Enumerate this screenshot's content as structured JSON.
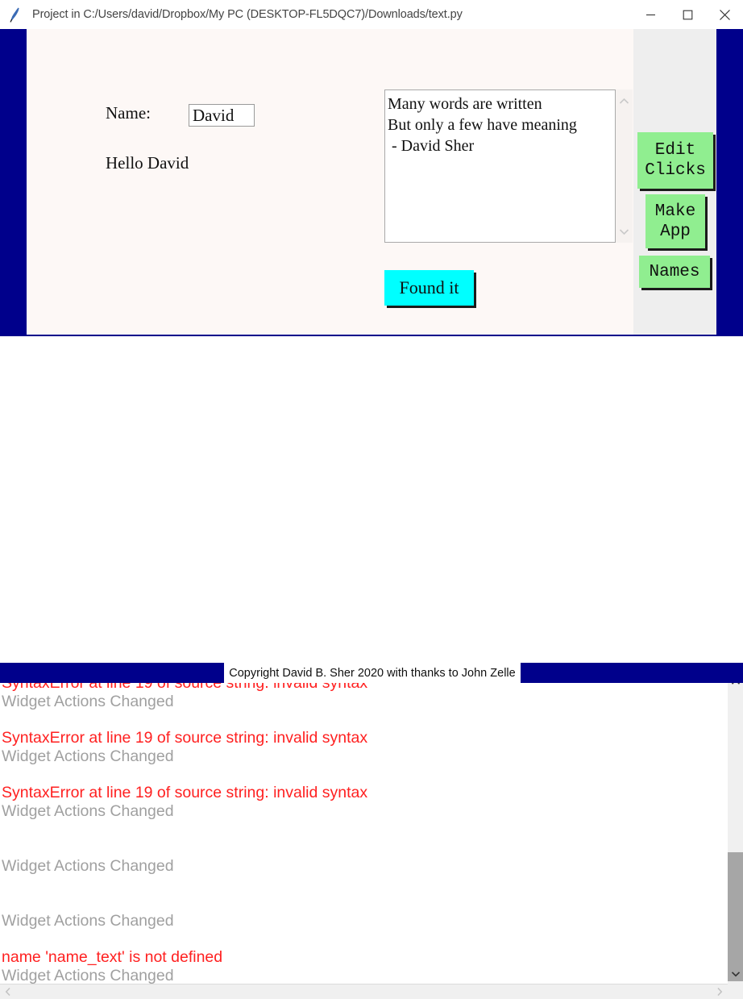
{
  "window": {
    "title": "Project in C:/Users/david/Dropbox/My PC (DESKTOP-FL5DQC7)/Downloads/text.py",
    "icon": "python-feather-icon",
    "controls": {
      "minimize": "minimize-icon",
      "maximize": "maximize-icon",
      "close": "close-icon"
    }
  },
  "app": {
    "name_label": "Name:",
    "name_value": "David",
    "greeting": "Hello David",
    "textarea_value": "Many words are written\nBut only a few have meaning\n - David Sher",
    "found_button": "Found it",
    "buttons": [
      {
        "label": "Edit\nClicks"
      },
      {
        "label": "Make\nApp"
      },
      {
        "label": "Names"
      }
    ],
    "colors": {
      "frame": "#00008b",
      "canvas": "#fdf8f6",
      "side_panel": "#eeeeee",
      "found_button": "#00ffff",
      "green_button": "#90ee90"
    }
  },
  "log": {
    "groups": [
      {
        "error": "SyntaxError at line 19 of source string: invalid syntax",
        "info": "Widget Actions Changed"
      },
      {
        "error": "SyntaxError at line 19 of source string: invalid syntax",
        "info": "Widget Actions Changed"
      },
      {
        "error": "SyntaxError at line 19 of source string: invalid syntax",
        "info": "Widget Actions Changed"
      },
      {
        "error": "",
        "info": "Widget Actions Changed"
      },
      {
        "error": "",
        "info": "Widget Actions Changed"
      },
      {
        "error": "name 'name_text' is not defined",
        "info": "Widget Actions Changed"
      }
    ],
    "colors": {
      "error": "#ff2020",
      "info": "#a0a0a0"
    }
  },
  "status": {
    "copyright": "Copyright David B. Sher 2020 with thanks to John Zelle"
  }
}
